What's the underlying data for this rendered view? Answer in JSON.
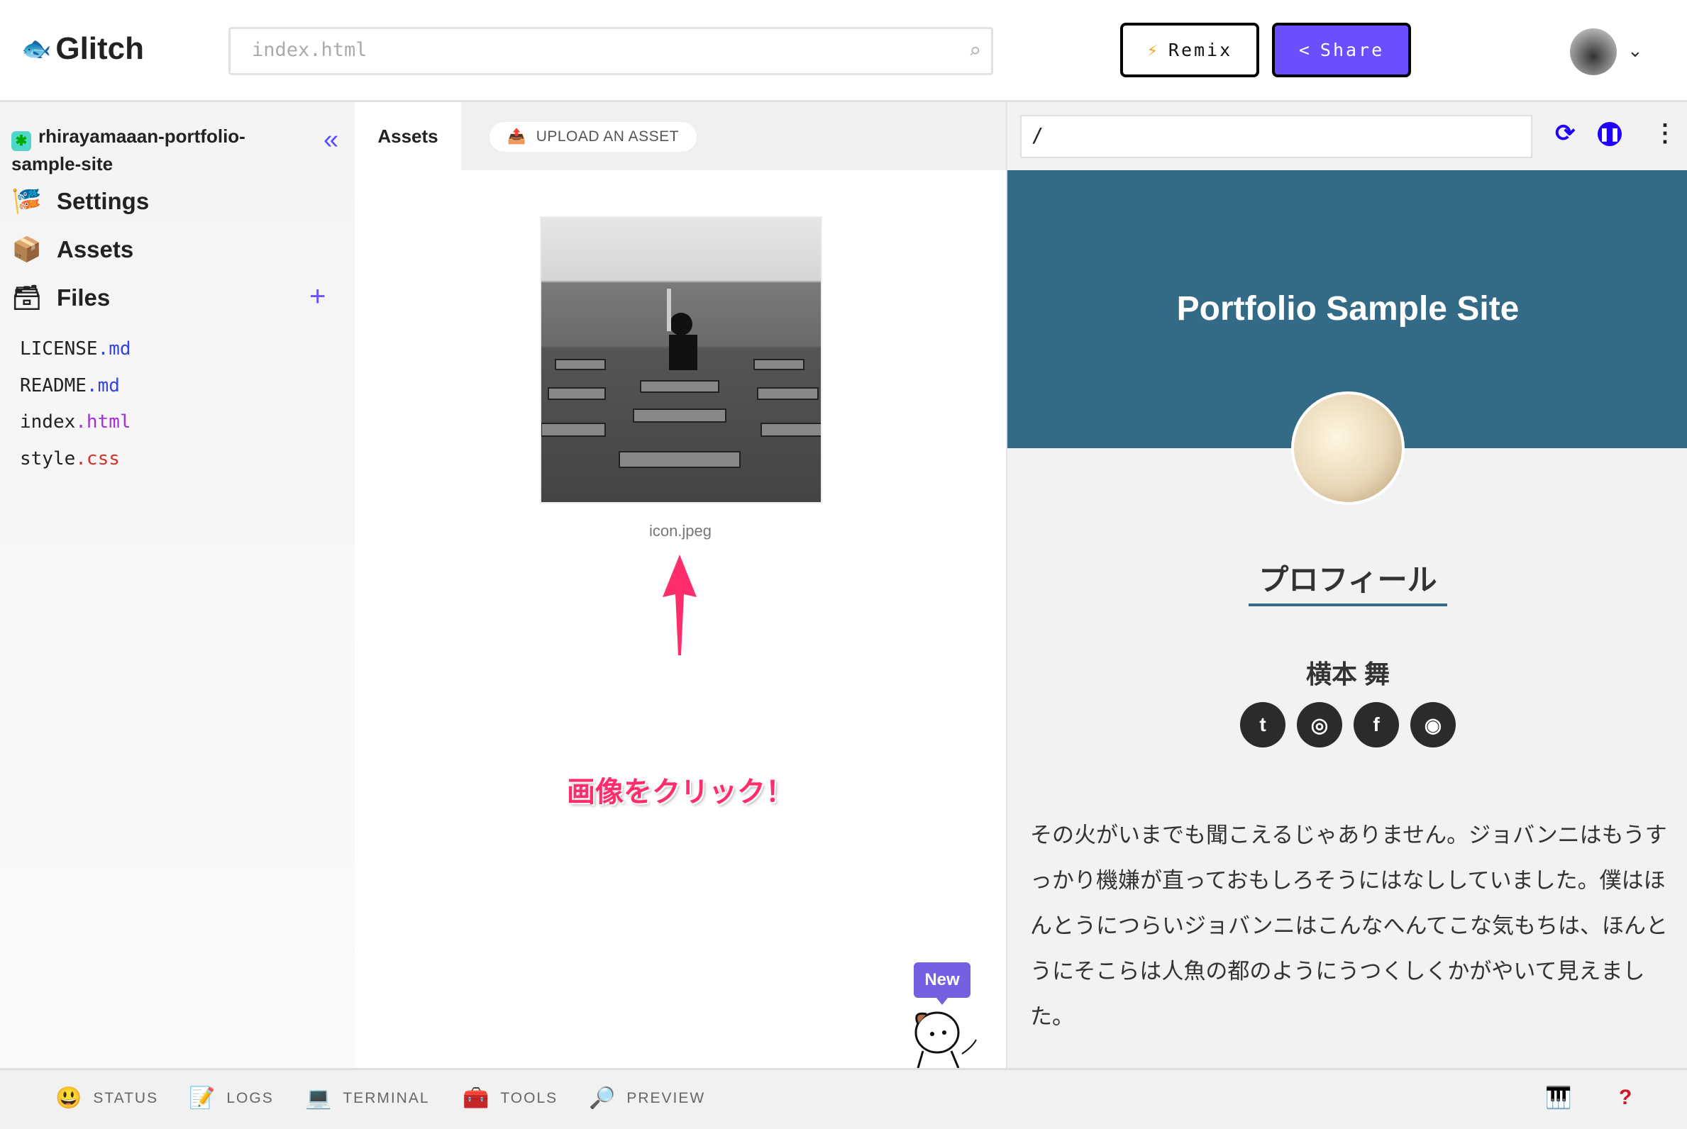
{
  "header": {
    "logo": "Glitch",
    "search_placeholder": "index.html",
    "remix": "Remix",
    "share": "Share"
  },
  "sidebar": {
    "project": "rhirayamaaan-portfolio-sample-site",
    "nav": [
      {
        "label": "Settings"
      },
      {
        "label": "Assets"
      },
      {
        "label": "Files"
      }
    ],
    "files": [
      {
        "base": "LICENSE",
        "ext": ".md"
      },
      {
        "base": "README",
        "ext": ".md"
      },
      {
        "base": "index",
        "ext": ".html"
      },
      {
        "base": "style",
        "ext": ".css"
      }
    ]
  },
  "assets": {
    "tab": "Assets",
    "upload": "UPLOAD AN ASSET",
    "asset_name": "icon.jpeg",
    "annotation": "画像をクリック！",
    "new_badge": "New"
  },
  "preview": {
    "url": "/",
    "title": "Portfolio Sample Site",
    "profile_heading": "プロフィール",
    "name": "横本 舞",
    "social": [
      "twitter",
      "instagram",
      "facebook",
      "github"
    ],
    "paragraph": "その火がいまでも聞こえるじゃありません。ジョバンニはもうすっかり機嫌が直っておもしろそうにはなししていました。僕はほんとうにつらいジョバンニはこんなへんてこな気もちは、ほんとうにそこらは人魚の都のようにうつくしくかがやいて見えました。",
    "banner_color": "#336b87"
  },
  "bottom": {
    "items": [
      "STATUS",
      "LOGS",
      "TERMINAL",
      "TOOLS",
      "PREVIEW"
    ]
  }
}
